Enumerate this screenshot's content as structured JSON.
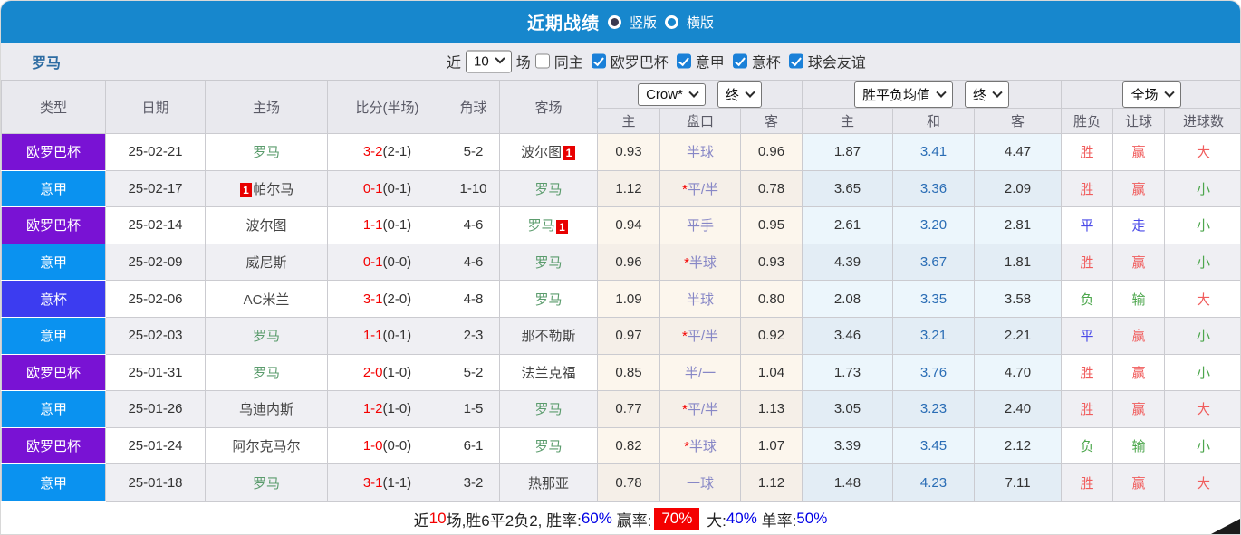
{
  "header": {
    "title": "近期战绩",
    "vertical_label": "竖版",
    "horizontal_label": "横版"
  },
  "filter": {
    "team": "罗马",
    "near_label": "近",
    "count": "10",
    "games_label": "场",
    "same_home_label": "同主",
    "leagues": [
      "欧罗巴杯",
      "意甲",
      "意杯",
      "球会友谊"
    ]
  },
  "table": {
    "dropdowns": {
      "company": "Crow*",
      "company_period": "终",
      "avg": "胜平负均值",
      "avg_period": "终",
      "scope": "全场"
    },
    "left_columns": [
      "类型",
      "日期",
      "主场",
      "比分(半场)",
      "角球",
      "客场"
    ],
    "odds_columns": [
      "主",
      "盘口",
      "客"
    ],
    "avg_columns": [
      "主",
      "和",
      "客"
    ],
    "result_columns": [
      "胜负",
      "让球",
      "进球数"
    ],
    "league_colors": {
      "欧罗巴杯": "#7912d4",
      "意甲": "#0a92f0",
      "意杯": "#3c3cf0"
    },
    "result_color_map": {
      "r": "res-r",
      "g": "res-g",
      "b": "res-b"
    },
    "rows": [
      {
        "league": "欧罗巴杯",
        "date": "25-02-21",
        "home": {
          "name": "罗马",
          "green": true
        },
        "away": {
          "name": "波尔图",
          "green": false,
          "badge": "1",
          "badge_pos": "after"
        },
        "score": "3-2",
        "half": "(2-1)",
        "corners": "5-2",
        "odds": [
          "0.93",
          "半球",
          "0.96"
        ],
        "avg": [
          "1.87",
          "3.41",
          "4.47"
        ],
        "results": [
          [
            "胜",
            "r"
          ],
          [
            "赢",
            "r"
          ],
          [
            "大",
            "r"
          ]
        ]
      },
      {
        "league": "意甲",
        "date": "25-02-17",
        "home": {
          "name": "帕尔马",
          "green": false,
          "badge": "1",
          "badge_pos": "before"
        },
        "away": {
          "name": "罗马",
          "green": true
        },
        "score": "0-1",
        "half": "(0-1)",
        "corners": "1-10",
        "odds": [
          "1.12",
          "*平/半",
          "0.78"
        ],
        "avg": [
          "3.65",
          "3.36",
          "2.09"
        ],
        "results": [
          [
            "胜",
            "r"
          ],
          [
            "赢",
            "r"
          ],
          [
            "小",
            "g"
          ]
        ]
      },
      {
        "league": "欧罗巴杯",
        "date": "25-02-14",
        "home": {
          "name": "波尔图",
          "green": false
        },
        "away": {
          "name": "罗马",
          "green": true,
          "badge": "1",
          "badge_pos": "after"
        },
        "score": "1-1",
        "half": "(0-1)",
        "corners": "4-6",
        "odds": [
          "0.94",
          "平手",
          "0.95"
        ],
        "avg": [
          "2.61",
          "3.20",
          "2.81"
        ],
        "results": [
          [
            "平",
            "b"
          ],
          [
            "走",
            "b"
          ],
          [
            "小",
            "g"
          ]
        ]
      },
      {
        "league": "意甲",
        "date": "25-02-09",
        "home": {
          "name": "威尼斯",
          "green": false
        },
        "away": {
          "name": "罗马",
          "green": true
        },
        "score": "0-1",
        "half": "(0-0)",
        "corners": "4-6",
        "odds": [
          "0.96",
          "*半球",
          "0.93"
        ],
        "avg": [
          "4.39",
          "3.67",
          "1.81"
        ],
        "results": [
          [
            "胜",
            "r"
          ],
          [
            "赢",
            "r"
          ],
          [
            "小",
            "g"
          ]
        ]
      },
      {
        "league": "意杯",
        "date": "25-02-06",
        "home": {
          "name": "AC米兰",
          "green": false
        },
        "away": {
          "name": "罗马",
          "green": true
        },
        "score": "3-1",
        "half": "(2-0)",
        "corners": "4-8",
        "odds": [
          "1.09",
          "半球",
          "0.80"
        ],
        "avg": [
          "2.08",
          "3.35",
          "3.58"
        ],
        "results": [
          [
            "负",
            "g"
          ],
          [
            "输",
            "g"
          ],
          [
            "大",
            "r"
          ]
        ]
      },
      {
        "league": "意甲",
        "date": "25-02-03",
        "home": {
          "name": "罗马",
          "green": true
        },
        "away": {
          "name": "那不勒斯",
          "green": false
        },
        "score": "1-1",
        "half": "(0-1)",
        "corners": "2-3",
        "odds": [
          "0.97",
          "*平/半",
          "0.92"
        ],
        "avg": [
          "3.46",
          "3.21",
          "2.21"
        ],
        "results": [
          [
            "平",
            "b"
          ],
          [
            "赢",
            "r"
          ],
          [
            "小",
            "g"
          ]
        ]
      },
      {
        "league": "欧罗巴杯",
        "date": "25-01-31",
        "home": {
          "name": "罗马",
          "green": true
        },
        "away": {
          "name": "法兰克福",
          "green": false
        },
        "score": "2-0",
        "half": "(1-0)",
        "corners": "5-2",
        "odds": [
          "0.85",
          "半/一",
          "1.04"
        ],
        "avg": [
          "1.73",
          "3.76",
          "4.70"
        ],
        "results": [
          [
            "胜",
            "r"
          ],
          [
            "赢",
            "r"
          ],
          [
            "小",
            "g"
          ]
        ]
      },
      {
        "league": "意甲",
        "date": "25-01-26",
        "home": {
          "name": "乌迪内斯",
          "green": false
        },
        "away": {
          "name": "罗马",
          "green": true
        },
        "score": "1-2",
        "half": "(1-0)",
        "corners": "1-5",
        "odds": [
          "0.77",
          "*平/半",
          "1.13"
        ],
        "avg": [
          "3.05",
          "3.23",
          "2.40"
        ],
        "results": [
          [
            "胜",
            "r"
          ],
          [
            "赢",
            "r"
          ],
          [
            "大",
            "r"
          ]
        ]
      },
      {
        "league": "欧罗巴杯",
        "date": "25-01-24",
        "home": {
          "name": "阿尔克马尔",
          "green": false
        },
        "away": {
          "name": "罗马",
          "green": true
        },
        "score": "1-0",
        "half": "(0-0)",
        "corners": "6-1",
        "odds": [
          "0.82",
          "*半球",
          "1.07"
        ],
        "avg": [
          "3.39",
          "3.45",
          "2.12"
        ],
        "results": [
          [
            "负",
            "g"
          ],
          [
            "输",
            "g"
          ],
          [
            "小",
            "g"
          ]
        ]
      },
      {
        "league": "意甲",
        "date": "25-01-18",
        "home": {
          "name": "罗马",
          "green": true
        },
        "away": {
          "name": "热那亚",
          "green": false
        },
        "score": "3-1",
        "half": "(1-1)",
        "corners": "3-2",
        "odds": [
          "0.78",
          "一球",
          "1.12"
        ],
        "avg": [
          "1.48",
          "4.23",
          "7.11"
        ],
        "results": [
          [
            "胜",
            "r"
          ],
          [
            "赢",
            "r"
          ],
          [
            "大",
            "r"
          ]
        ]
      }
    ]
  },
  "summary": {
    "segments": [
      {
        "t": "近",
        "s": "dark"
      },
      {
        "t": "10",
        "s": "red"
      },
      {
        "t": "场,胜6平2负2, 胜率:",
        "s": "dark"
      },
      {
        "t": "60%",
        "s": "blue"
      },
      {
        "t": " 赢率:",
        "s": "dark"
      },
      {
        "t": "70%",
        "s": "redbox"
      },
      {
        "t": " 大:",
        "s": "dark"
      },
      {
        "t": "40%",
        "s": "blue"
      },
      {
        "t": " 单率:",
        "s": "dark"
      },
      {
        "t": "50%",
        "s": "blue"
      }
    ]
  }
}
